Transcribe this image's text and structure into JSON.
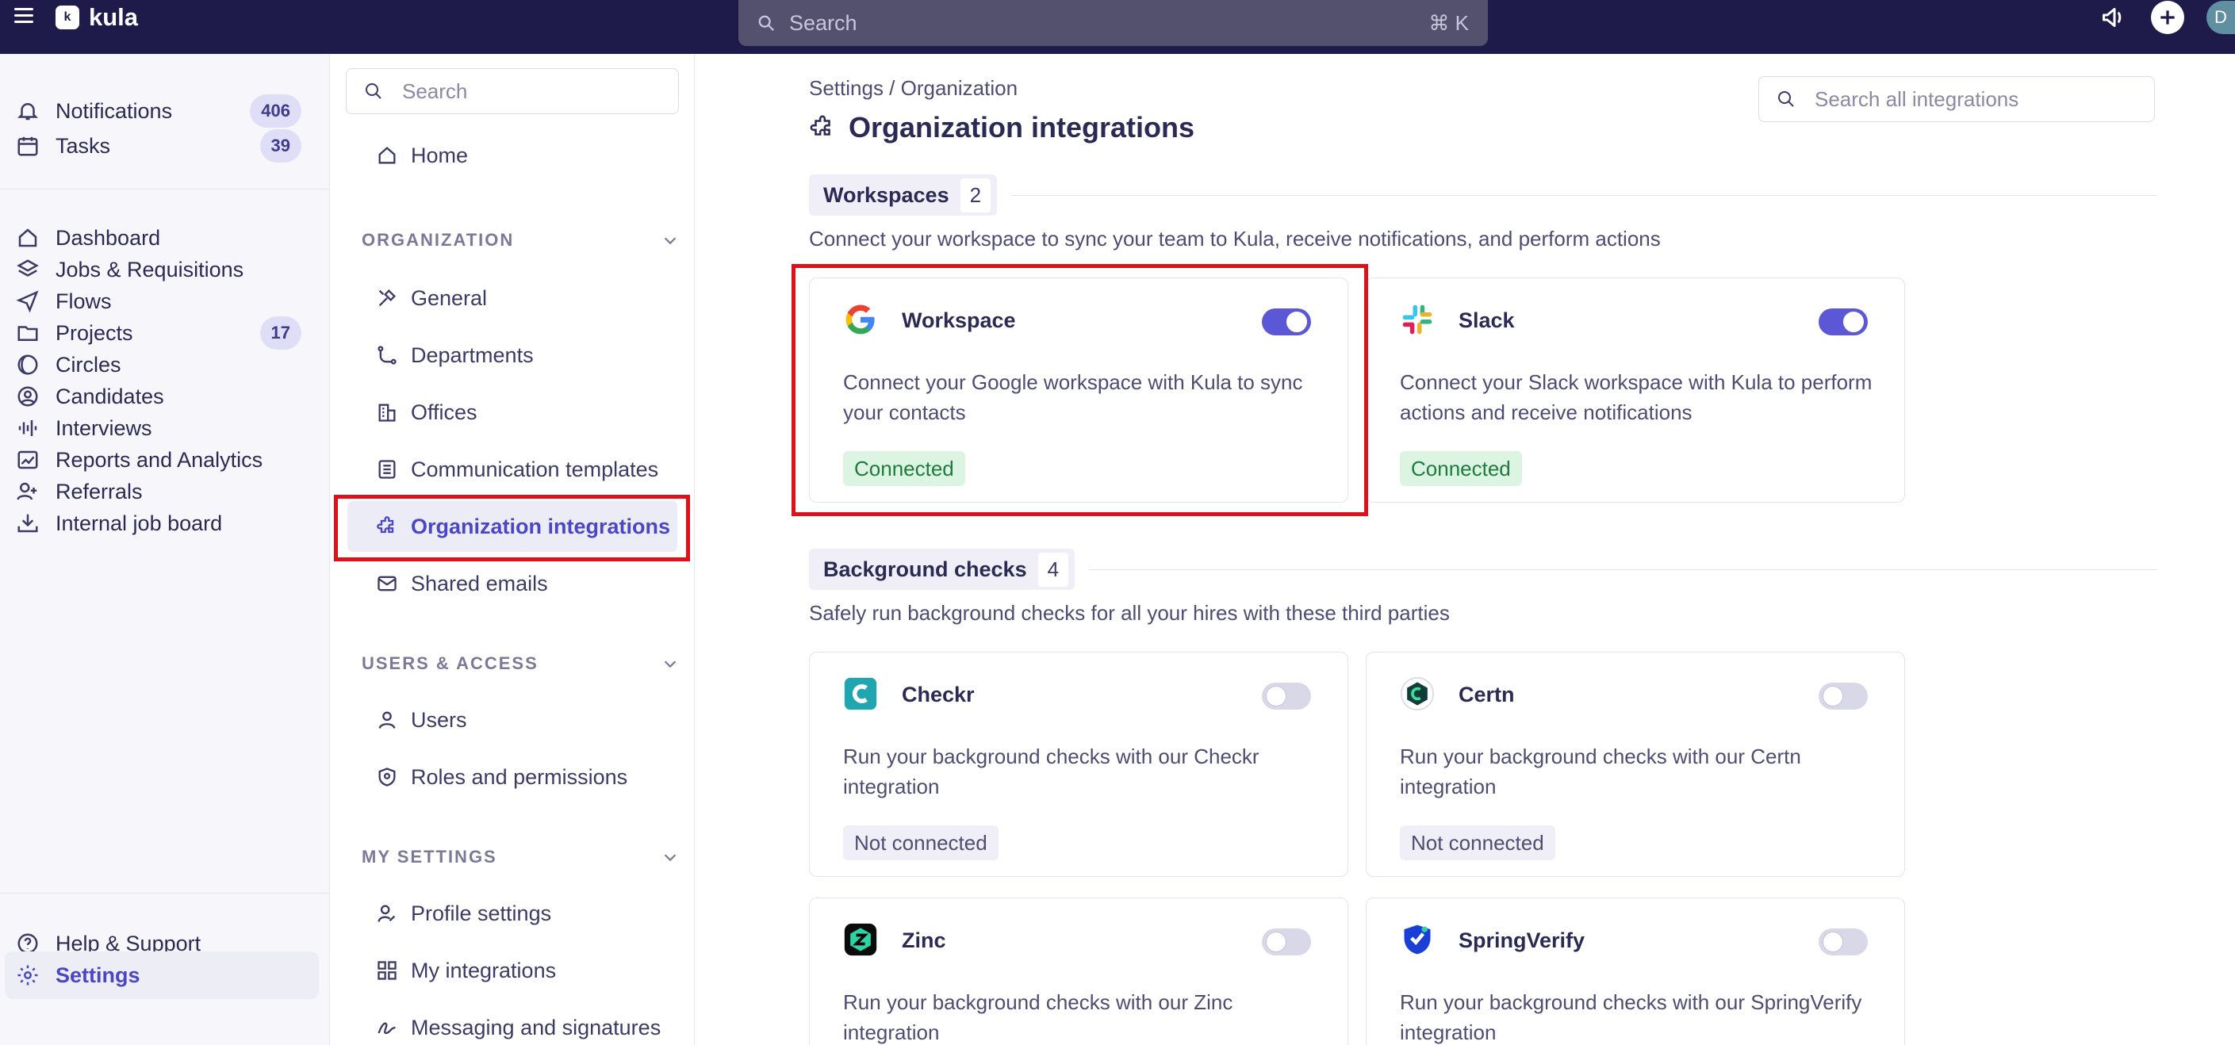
{
  "topbar": {
    "brand": "kula",
    "logo_mark": "k",
    "search_placeholder": "Search",
    "search_shortcut": "⌘ K",
    "avatar_initial": "D",
    "icons": [
      "menu-icon",
      "megaphone-icon",
      "plus-icon"
    ]
  },
  "leftnav": {
    "notifications": {
      "label": "Notifications",
      "count": "406"
    },
    "tasks": {
      "label": "Tasks",
      "count": "39"
    },
    "dashboard": {
      "label": "Dashboard"
    },
    "jobs": {
      "label": "Jobs & Requisitions"
    },
    "flows": {
      "label": "Flows"
    },
    "projects": {
      "label": "Projects",
      "count": "17"
    },
    "circles": {
      "label": "Circles"
    },
    "candidates": {
      "label": "Candidates"
    },
    "interviews": {
      "label": "Interviews"
    },
    "reports": {
      "label": "Reports and Analytics"
    },
    "referrals": {
      "label": "Referrals"
    },
    "jobboard": {
      "label": "Internal job board"
    },
    "help": {
      "label": "Help & Support"
    },
    "settings": {
      "label": "Settings"
    }
  },
  "subnav": {
    "search_placeholder": "Search",
    "home": "Home",
    "organization_title": "ORGANIZATION",
    "general": "General",
    "departments": "Departments",
    "offices": "Offices",
    "templates": "Communication templates",
    "org_integrations": "Organization integrations",
    "shared_emails": "Shared emails",
    "users_title": "USERS & ACCESS",
    "users": "Users",
    "roles": "Roles and permissions",
    "my_settings_title": "MY SETTINGS",
    "profile": "Profile settings",
    "my_integrations": "My integrations",
    "messaging": "Messaging and signatures"
  },
  "main": {
    "breadcrumb": "Settings / Organization",
    "title": "Organization integrations",
    "search_placeholder": "Search all integrations",
    "workspaces": {
      "name": "Workspaces",
      "count": "2",
      "desc": "Connect your workspace to sync your team to Kula, receive notifications, and perform actions",
      "cards": [
        {
          "name": "Workspace",
          "desc": "Connect your Google workspace with Kula to sync your contacts",
          "status": "Connected",
          "enabled": true,
          "icon": "google-icon"
        },
        {
          "name": "Slack",
          "desc": "Connect your Slack workspace with Kula to perform actions and receive notifications",
          "status": "Connected",
          "enabled": true,
          "icon": "slack-icon"
        }
      ]
    },
    "background": {
      "name": "Background checks",
      "count": "4",
      "desc": "Safely run background checks for all your hires with these third parties",
      "cards": [
        {
          "name": "Checkr",
          "desc": "Run your background checks with our Checkr integration",
          "status": "Not connected",
          "enabled": false,
          "icon": "checkr-icon"
        },
        {
          "name": "Certn",
          "desc": "Run your background checks with our Certn integration",
          "status": "Not connected",
          "enabled": false,
          "icon": "certn-icon"
        },
        {
          "name": "Zinc",
          "desc": "Run your background checks with our Zinc integration",
          "enabled": false,
          "icon": "zinc-icon"
        },
        {
          "name": "SpringVerify",
          "desc": "Run your background checks with our SpringVerify integration",
          "enabled": false,
          "icon": "springverify-icon"
        }
      ]
    }
  },
  "colors": {
    "topbar": "#1e1b4b",
    "accent": "#5b57d6",
    "highlight": "#e0101b",
    "connected_bg": "#dcf5e3",
    "connected_text": "#1f7a3d"
  }
}
